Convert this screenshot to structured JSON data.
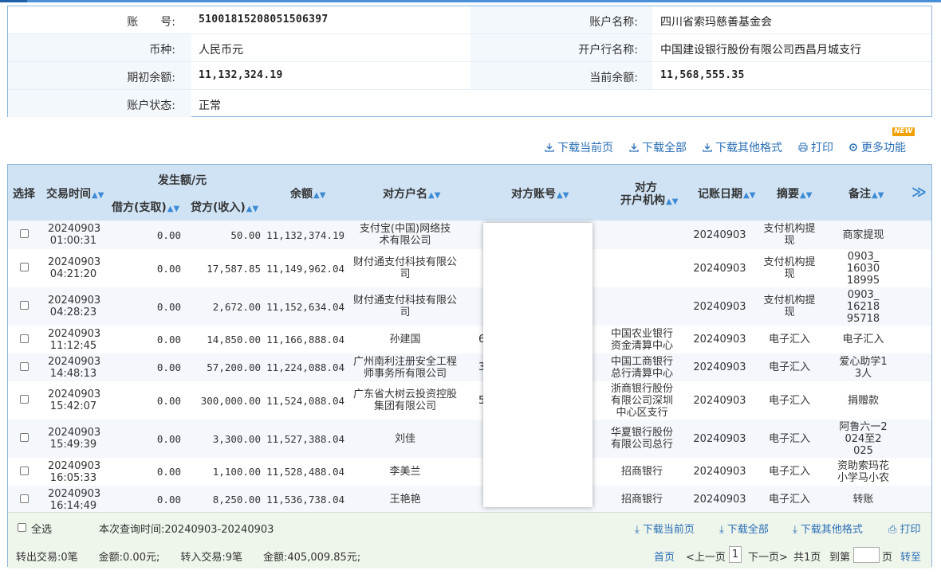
{
  "account": {
    "account_no_label": "账　　号:",
    "account_no": "51001815208051506397",
    "account_name_label": "账户名称:",
    "account_name": "四川省索玛慈善基金会",
    "currency_label": "币种:",
    "currency": "人民币元",
    "bank_label": "开户行名称:",
    "bank": "中国建设银行股份有限公司西昌月城支行",
    "opening_balance_label": "期初余额:",
    "opening_balance": "11,132,324.19",
    "current_balance_label": "当前余额:",
    "current_balance": "11,568,555.35",
    "status_label": "账户状态:",
    "status": "正常"
  },
  "new_badge": "NEW",
  "toolbar": {
    "download_page": "下载当前页",
    "download_all": "下载全部",
    "download_other": "下载其他格式",
    "print": "打印",
    "more": "更多功能"
  },
  "table": {
    "headers": {
      "select": "选择",
      "time": "交易时间",
      "amount_group": "发生额/元",
      "debit": "借方(支取)",
      "credit": "贷方(收入)",
      "balance": "余额",
      "counterparty_name": "对方户名",
      "counterparty_account": "对方账号",
      "counterparty_bank_1": "对方",
      "counterparty_bank_2": "开户机构",
      "post_date": "记账日期",
      "summary": "摘要",
      "remark": "备注",
      "more": "≫"
    },
    "rows": [
      {
        "date": "20240903",
        "time": "01:00:31",
        "debit": "0.00",
        "credit": "50.00",
        "balance": "11,132,374.19",
        "name1": "支付宝(中国)网络技",
        "name2": "术有限公司",
        "acct": "",
        "bank1": "",
        "bank2": "",
        "bank3": "",
        "post": "20240903",
        "sum1": "支付机构提",
        "sum2": "现",
        "rem1": "商家提现",
        "rem2": "",
        "rem3": ""
      },
      {
        "date": "20240903",
        "time": "04:21:20",
        "debit": "0.00",
        "credit": "17,587.85",
        "balance": "11,149,962.04",
        "name1": "财付通支付科技有限公",
        "name2": "司",
        "acct": "",
        "bank1": "",
        "bank2": "",
        "bank3": "",
        "post": "20240903",
        "sum1": "支付机构提",
        "sum2": "现",
        "rem1": "0903_",
        "rem2": "16030",
        "rem3": "18995"
      },
      {
        "date": "20240903",
        "time": "04:28:23",
        "debit": "0.00",
        "credit": "2,672.00",
        "balance": "11,152,634.04",
        "name1": "财付通支付科技有限公",
        "name2": "司",
        "acct": "",
        "bank1": "",
        "bank2": "",
        "bank3": "",
        "post": "20240903",
        "sum1": "支付机构提",
        "sum2": "现",
        "rem1": "0903_",
        "rem2": "16218",
        "rem3": "95718"
      },
      {
        "date": "20240903",
        "time": "11:12:45",
        "debit": "0.00",
        "credit": "14,850.00",
        "balance": "11,166,888.04",
        "name1": "孙建国",
        "name2": "",
        "acct": "6",
        "bank1": "中国农业银行",
        "bank2": "资金清算中心",
        "bank3": "",
        "post": "20240903",
        "sum1": "电子汇入",
        "sum2": "",
        "rem1": "电子汇入",
        "rem2": "",
        "rem3": ""
      },
      {
        "date": "20240903",
        "time": "14:48:13",
        "debit": "0.00",
        "credit": "57,200.00",
        "balance": "11,224,088.04",
        "name1": "广州南利注册安全工程",
        "name2": "师事务所有限公司",
        "acct": "3",
        "bank1": "中国工商银行",
        "bank2": "总行清算中心",
        "bank3": "",
        "post": "20240903",
        "sum1": "电子汇入",
        "sum2": "",
        "rem1": "爱心助学1",
        "rem2": "3人",
        "rem3": ""
      },
      {
        "date": "20240903",
        "time": "15:42:07",
        "debit": "0.00",
        "credit": "300,000.00",
        "balance": "11,524,088.04",
        "name1": "广东省大树云投资控股",
        "name2": "集团有限公司",
        "acct": "5",
        "bank1": "浙商银行股份",
        "bank2": "有限公司深圳",
        "bank3": "中心区支行",
        "post": "20240903",
        "sum1": "电子汇入",
        "sum2": "",
        "rem1": "捐赠款",
        "rem2": "",
        "rem3": ""
      },
      {
        "date": "20240903",
        "time": "15:49:39",
        "debit": "0.00",
        "credit": "3,300.00",
        "balance": "11,527,388.04",
        "name1": "刘佳",
        "name2": "",
        "acct": "",
        "bank1": "华夏银行股份",
        "bank2": "有限公司总行",
        "bank3": "",
        "post": "20240903",
        "sum1": "电子汇入",
        "sum2": "",
        "rem1": "阿鲁六一2",
        "rem2": "024至2",
        "rem3": "025"
      },
      {
        "date": "20240903",
        "time": "16:05:33",
        "debit": "0.00",
        "credit": "1,100.00",
        "balance": "11,528,488.04",
        "name1": "李美兰",
        "name2": "",
        "acct": "",
        "bank1": "招商银行",
        "bank2": "",
        "bank3": "",
        "post": "20240903",
        "sum1": "电子汇入",
        "sum2": "",
        "rem1": "资助索玛花",
        "rem2": "小学马小农",
        "rem3": ""
      },
      {
        "date": "20240903",
        "time": "16:14:49",
        "debit": "0.00",
        "credit": "8,250.00",
        "balance": "11,536,738.04",
        "name1": "王艳艳",
        "name2": "",
        "acct": "",
        "bank1": "招商银行",
        "bank2": "",
        "bank3": "",
        "post": "20240903",
        "sum1": "电子汇入",
        "sum2": "",
        "rem1": "转账",
        "rem2": "",
        "rem3": ""
      }
    ]
  },
  "footer": {
    "select_all": "全选",
    "query_time": "本次查询时间:20240903-20240903",
    "download_page": "下载当前页",
    "download_all": "下载全部",
    "download_other": "下载其他格式",
    "print": "打印",
    "out_summary": "转出交易:0笔　　金额:0.00元;　　转入交易:9笔　　金额:405,009.85元;",
    "first_page": "首页",
    "prev_page": "<上一页",
    "current_page": "1",
    "next_page": "下一页>",
    "total_pages": "共1页",
    "goto_label": "到第",
    "goto_value": "",
    "page_unit": "页",
    "goto_button": "转至"
  },
  "colors": {
    "accent": "#2b6fb6",
    "header_bg": "#cfe3f5",
    "border": "#8fb6dc",
    "footer_bg": "#eef5eb"
  }
}
